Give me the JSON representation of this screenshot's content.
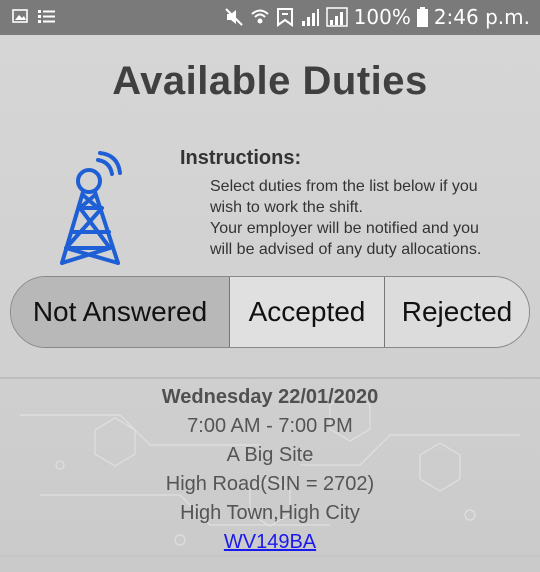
{
  "status_bar": {
    "battery": "100%",
    "time": "2:46 p.m."
  },
  "page": {
    "title": "Available Duties"
  },
  "instructions": {
    "heading": "Instructions:",
    "lines": [
      "Select duties from the list below if you",
      "wish to work the shift.",
      "Your employer will be notified and you",
      "will be advised of any duty allocations."
    ]
  },
  "tabs": [
    {
      "label": "Not Answered",
      "selected": true
    },
    {
      "label": "Accepted",
      "selected": false
    },
    {
      "label": "Rejected",
      "selected": false
    }
  ],
  "duty": {
    "date": "Wednesday 22/01/2020",
    "time_range": "7:00 AM - 7:00 PM",
    "site": "A Big Site",
    "address_line1": "High Road(SIN = 2702)",
    "address_line2": "High Town,High City",
    "reference": "WV149BA"
  },
  "colors": {
    "status_bar": "#7a7a7a",
    "tower_icon": "#1e5fd6",
    "link": "#1a1aee",
    "tab_selected": "#b8b8b8"
  }
}
